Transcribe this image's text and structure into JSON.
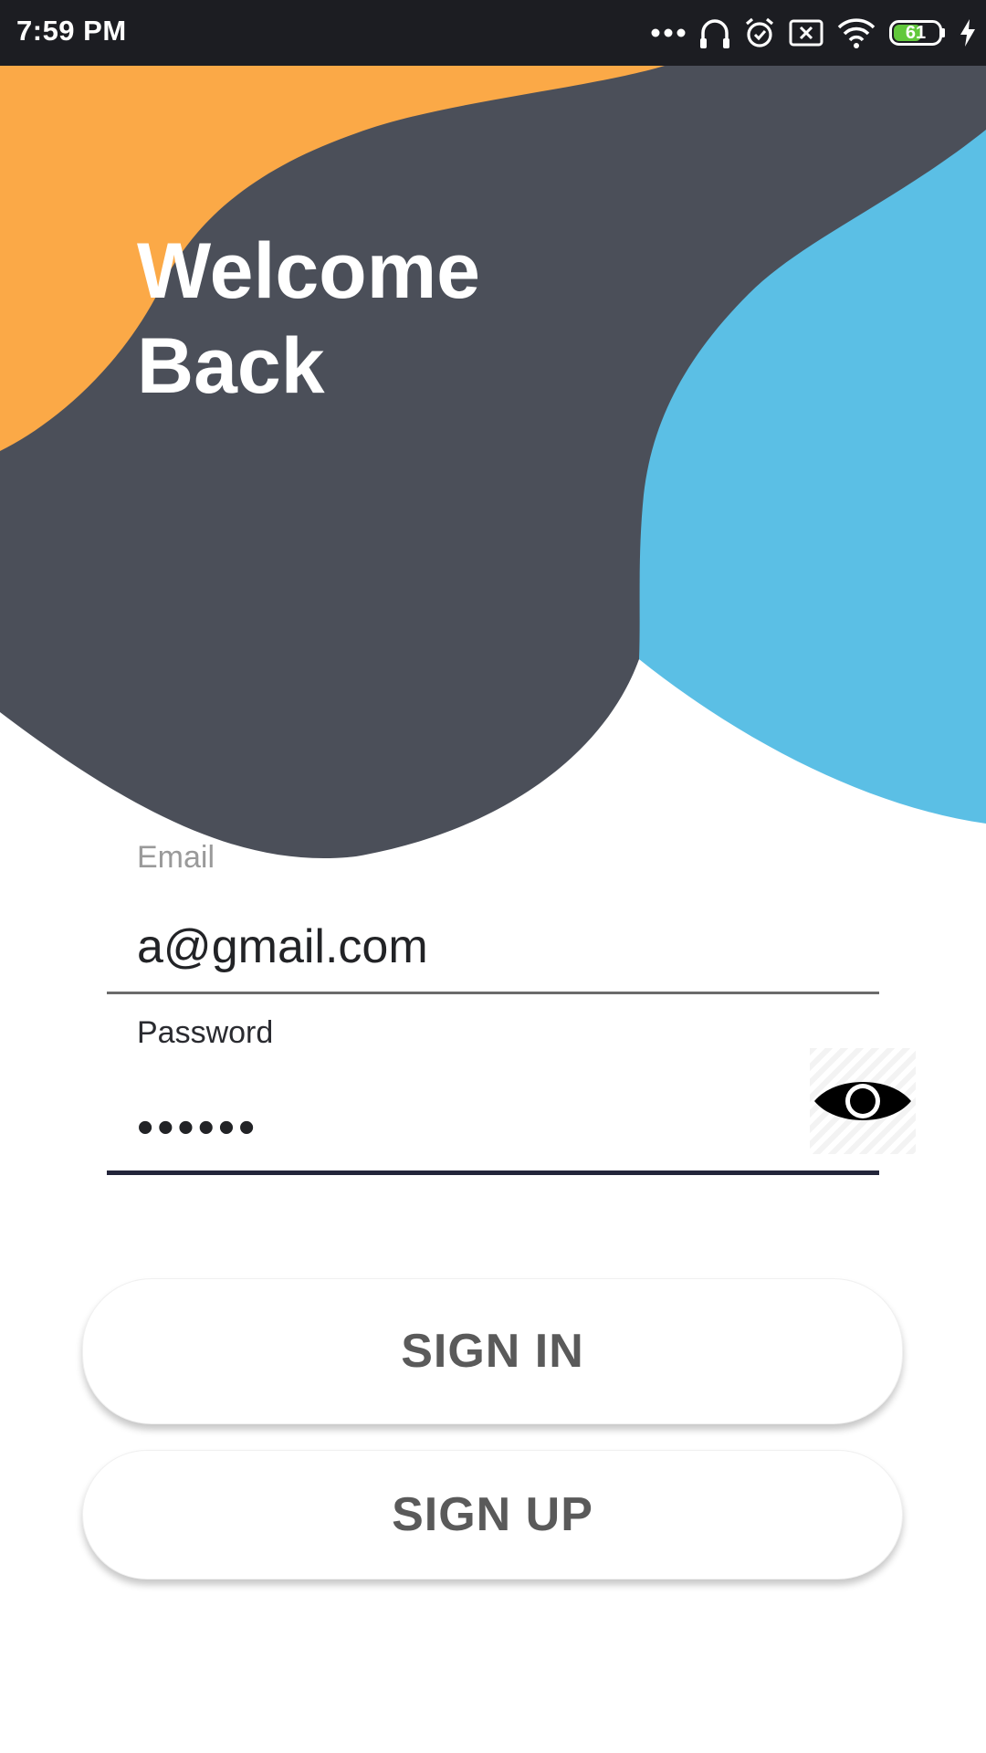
{
  "status_bar": {
    "time": "7:59 PM",
    "battery_level": "61",
    "icons": [
      "more-dots-icon",
      "headphones-icon",
      "alarm-icon",
      "no-sim-icon",
      "wifi-icon",
      "battery-icon",
      "charging-bolt-icon"
    ]
  },
  "header": {
    "title_line1": "Welcome",
    "title_line2": "Back"
  },
  "form": {
    "email": {
      "label": "Email",
      "value": "a@gmail.com"
    },
    "password": {
      "label": "Password",
      "value": "••••••",
      "toggle_icon": "eye-icon"
    }
  },
  "actions": {
    "sign_in_label": "SIGN IN",
    "sign_up_label": "SIGN UP"
  },
  "colors": {
    "status_bar_bg": "#1c1d22",
    "blob_orange": "#fba947",
    "blob_dark": "#4b4f59",
    "blob_blue": "#5bbfe5",
    "button_text": "#5a5a5a",
    "password_underline": "#23253a"
  }
}
